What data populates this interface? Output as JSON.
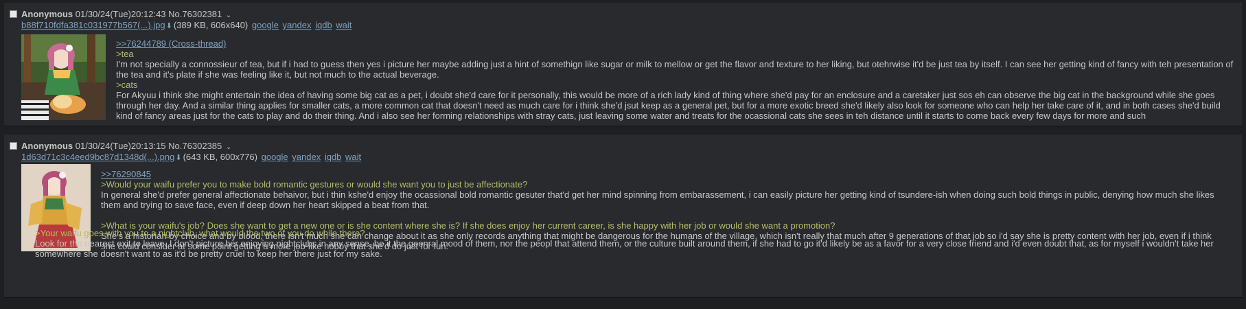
{
  "posts": [
    {
      "name": "Anonymous",
      "datetime": "01/30/24(Tue)20:12:43",
      "post_no": "No.76302381",
      "file_name": "b88f710fdfa381c031977b567(...).jpg",
      "file_info": "(389 KB, 606x640)",
      "services": [
        "google",
        "yandex",
        "iqdb",
        "wait"
      ],
      "quotelink": ">>76244789 (Cross-thread)",
      "sections": [
        {
          "greentext": ">tea",
          "text": "I'm not specially a connossieur of tea, but if i had to guess then yes i picture her maybe adding just a hint of somethign like sugar or milk to mellow or get the flavor and texture to her liking, but otehrwise it'd be just tea by itself. I can see her getting kind of fancy with teh presentation of the tea and it's plate if she was feeling like it, but not much to the actual beverage."
        },
        {
          "greentext": ">cats",
          "text": "For Akyuu i think she might entertain the idea of having some big cat as a pet, i doubt she'd care for it personally, this would be more of a rich lady kind of thing where she'd pay for an enclosure and a caretaker just sos eh can observe the big cat in the background while she goes through her day. And a similar thing applies for smaller cats, a more common cat that doesn't need as much care for i think she'd jsut keep as a general pet, but for a more exotic breed she'd likely also look for someone who can help her take care of it, and in both cases she'd build kind of fancy areas just for the cats to play and do their thing. And i also see her forming relationships with stray cats, just leaving some water and treats for the ocassional cats she sees in teh distance until it starts to come back every few days for more and such"
        }
      ]
    },
    {
      "name": "Anonymous",
      "datetime": "01/30/24(Tue)20:13:15",
      "post_no": "No.76302385",
      "file_name": "1d63d71c3c4eed9bc87d1348d(...).png",
      "file_info": "(643 KB, 600x776)",
      "services": [
        "google",
        "yandex",
        "iqdb",
        "wait"
      ],
      "quotelink": ">>76290845",
      "sections": [
        {
          "greentext": ">Would your waifu prefer you to make bold romantic gestures or would she want you to just be affectionate?",
          "text": "In general she'd prefer general affectionate behaivor, but i thin kshe'd enjoy the ocassional bold romantic gesuter that'd get her mind spinning from embarassement, i can easily picture her getting kind of tsundere-ish when doing such bold things in public, denying how much she likes them and trying to save face, even if deep down her heart skipped a beat from that."
        },
        {
          "greentext": ">What is your waifu's job? Does she want to get a new one or is she content where she is? If she does enjoy her current career, is she happy with her job or would she want a promotion?",
          "text": "She's a historian by choice and by blood, there isn't much she can change about it as she only records anything that might be dangerous for the humans of the village, which isn't really that much after 9 generations of that job so i'd say she is pretty content with her job, even if i think she could consider at some point getting a more job-like hobby that she'd do just for fun."
        },
        {
          "greentext": ">Your waifu goes with you to a nightclub, what would the two of you do while there?",
          "text": "Look for the nearest exit to leave. I don't picture her enjoying nightclubs in any sense, be it the geenral mood of them, nor the peopl that attend them, or the culture built around them, if she had to go it'd likely be as a favor for a very close friend and i'd even doubt that, as for myself i wouldn't take her somewhere she doesn't want to as it'd be pretty cruel to keep her there just for my sake."
        }
      ]
    }
  ]
}
